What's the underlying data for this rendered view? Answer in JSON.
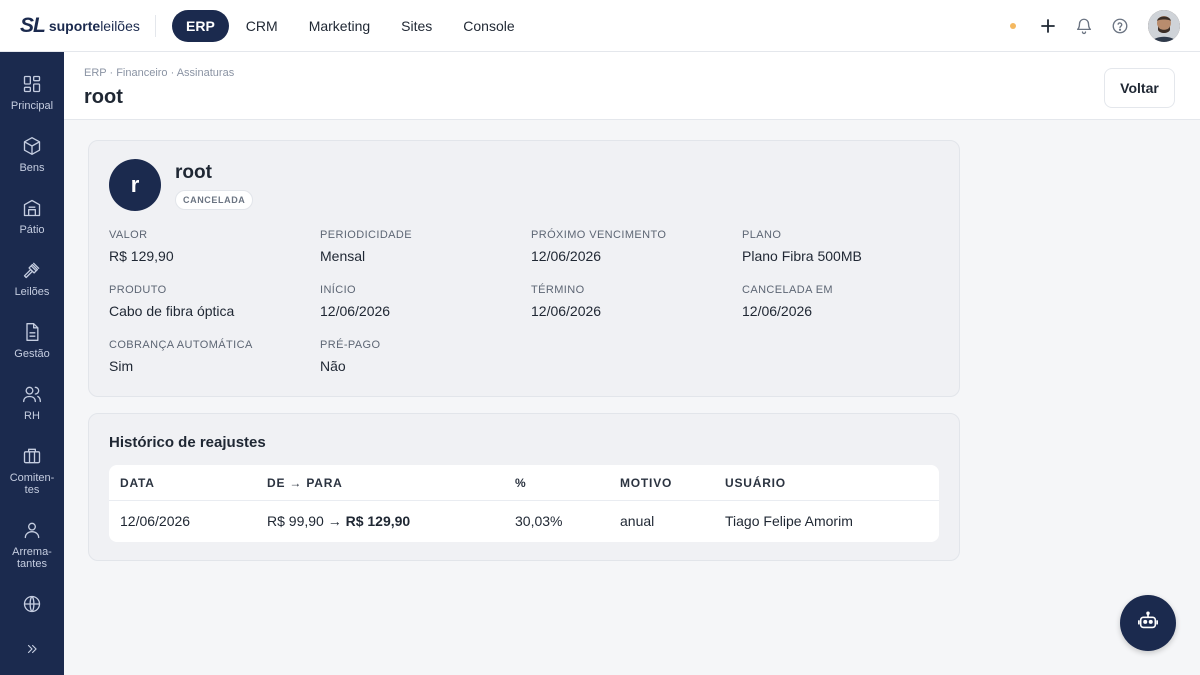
{
  "brand": {
    "mark": "SL",
    "name_bold": "suporte",
    "name_light": "leilões"
  },
  "topnav": {
    "items": [
      {
        "label": "ERP",
        "active": true
      },
      {
        "label": "CRM",
        "active": false
      },
      {
        "label": "Marketing",
        "active": false
      },
      {
        "label": "Sites",
        "active": false
      },
      {
        "label": "Console",
        "active": false
      }
    ]
  },
  "topbar_icons": [
    "status-dot",
    "plus-icon",
    "bell-icon",
    "help-icon",
    "user-avatar"
  ],
  "sidebar": {
    "items": [
      {
        "label": "Principal",
        "icon": "dashboard-icon"
      },
      {
        "label": "Bens",
        "icon": "box-icon"
      },
      {
        "label": "Pátio",
        "icon": "building-icon"
      },
      {
        "label": "Leilões",
        "icon": "gavel-icon"
      },
      {
        "label": "Gestão",
        "icon": "document-icon"
      },
      {
        "label": "RH",
        "icon": "users-icon"
      },
      {
        "label": "Comiten-\ntes",
        "icon": "briefcase-icon"
      },
      {
        "label": "Arrema-\ntantes",
        "icon": "person-icon"
      },
      {
        "label": "",
        "icon": "globe-icon"
      }
    ],
    "expand_icon": "chevrons-right-icon"
  },
  "header": {
    "breadcrumb": "ERP · Financeiro · Assinaturas",
    "title": "root",
    "back_label": "Voltar"
  },
  "subscription": {
    "avatar_letter": "r",
    "name": "root",
    "status": "CANCELADA",
    "fields": {
      "valor": {
        "label": "VALOR",
        "value": "R$ 129,90"
      },
      "periodicidade": {
        "label": "PERIODICIDADE",
        "value": "Mensal"
      },
      "proximo_vencimento": {
        "label": "PRÓXIMO VENCIMENTO",
        "value": "12/06/2026"
      },
      "plano": {
        "label": "PLANO",
        "value": "Plano Fibra 500MB"
      },
      "produto": {
        "label": "PRODUTO",
        "value": "Cabo de fibra óptica"
      },
      "inicio": {
        "label": "INÍCIO",
        "value": "12/06/2026"
      },
      "termino": {
        "label": "TÉRMINO",
        "value": "12/06/2026"
      },
      "cancelada_em": {
        "label": "CANCELADA EM",
        "value": "12/06/2026"
      },
      "cobranca_automatica": {
        "label": "COBRANÇA AUTOMÁTICA",
        "value": "Sim"
      },
      "pre_pago": {
        "label": "PRÉ-PAGO",
        "value": "Não"
      }
    }
  },
  "history": {
    "title": "Histórico de reajustes",
    "columns": [
      "DATA",
      "DE → PARA",
      "%",
      "MOTIVO",
      "USUÁRIO"
    ],
    "rows": [
      {
        "data": "12/06/2026",
        "de": "R$ 99,90",
        "arrow": "→",
        "para": "R$ 129,90",
        "percent": "30,03%",
        "motivo": "anual",
        "usuario": "Tiago Felipe Amorim"
      }
    ]
  },
  "assistant": {
    "icon": "robot-icon"
  },
  "colors": {
    "primary": "#1b2a4e",
    "background": "#f5f6f8",
    "card": "#f0f1f4",
    "status_dot": "#f4b860"
  }
}
